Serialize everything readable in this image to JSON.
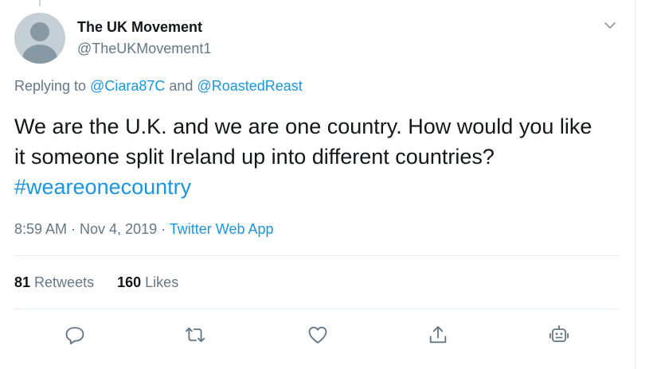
{
  "tweet": {
    "author": {
      "display_name": "The UK Movement",
      "handle": "@TheUKMovement1"
    },
    "reply": {
      "prefix": "Replying to ",
      "mention_1": "@Ciara87C",
      "joiner": " and ",
      "mention_2": "@RoastedReast"
    },
    "text": "We are the U.K. and we are one country. How would you like it someone split Ireland up into different countries? ",
    "hashtag": "#weareonecountry",
    "time": "8:59 AM",
    "separator": " · ",
    "date": "Nov 4, 2019",
    "source": "Twitter Web App",
    "retweets": {
      "count": "81",
      "label": "Retweets"
    },
    "likes": {
      "count": "160",
      "label": "Likes"
    }
  },
  "icons": {
    "caret": "chevron-down-icon",
    "reply": "reply-icon",
    "retweet": "retweet-icon",
    "like": "heart-icon",
    "share": "share-icon",
    "bot": "bot-icon"
  },
  "colors": {
    "link": "#1b95e0",
    "secondary_text": "#657786",
    "primary_text": "#14171a",
    "divider": "#e6ecf0"
  }
}
